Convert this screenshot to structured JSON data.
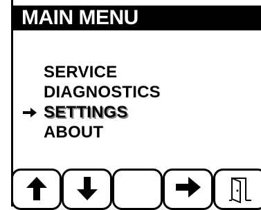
{
  "header": {
    "title": "MAIN MENU"
  },
  "menu": {
    "items": [
      {
        "label": "SERVICE",
        "selected": false
      },
      {
        "label": "DIAGNOSTICS",
        "selected": false
      },
      {
        "label": "SETTINGS",
        "selected": true
      },
      {
        "label": "ABOUT",
        "selected": false
      }
    ],
    "cursor_icon": "right-arrow-icon"
  },
  "softkeys": [
    {
      "icon": "arrow-up-icon"
    },
    {
      "icon": "arrow-down-icon"
    },
    {
      "icon": ""
    },
    {
      "icon": "arrow-right-icon"
    },
    {
      "icon": "exit-door-icon"
    }
  ],
  "colors": {
    "background": "#ffffff",
    "foreground": "#000000",
    "selection_shadow": "#8a8a8a"
  }
}
